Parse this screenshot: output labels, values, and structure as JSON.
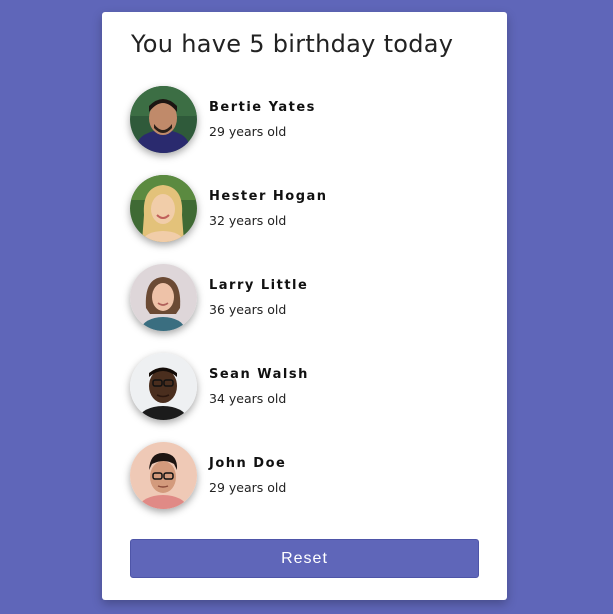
{
  "colors": {
    "background": "#5f66b9",
    "card": "#ffffff",
    "button": "#5f66b9"
  },
  "header": {
    "title": "You have 5 birthday today"
  },
  "people": [
    {
      "name": "Bertie Yates",
      "age": "29 years old",
      "avatar_icon": "avatar-photo"
    },
    {
      "name": "Hester Hogan",
      "age": "32 years old",
      "avatar_icon": "avatar-photo"
    },
    {
      "name": "Larry Little",
      "age": "36 years old",
      "avatar_icon": "avatar-photo"
    },
    {
      "name": "Sean Walsh",
      "age": "34 years old",
      "avatar_icon": "avatar-photo"
    },
    {
      "name": "John Doe",
      "age": "29 years old",
      "avatar_icon": "avatar-photo"
    }
  ],
  "actions": {
    "reset_label": "Reset"
  }
}
